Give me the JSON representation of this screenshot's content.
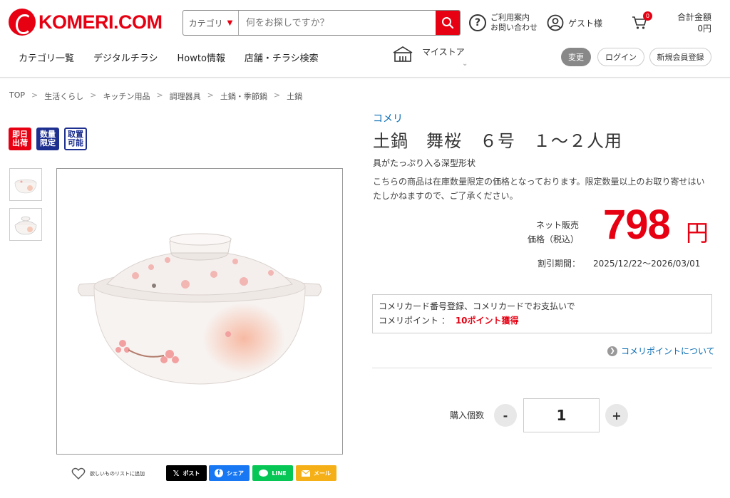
{
  "header": {
    "logo_text": "KOMERI.COM",
    "search": {
      "category_label": "カテゴリ",
      "placeholder": "何をお探しですか？"
    },
    "help_line1": "ご利用案内",
    "help_line2": "お問い合わせ",
    "guest_label": "ゲスト様",
    "cart_count": "0",
    "total_label": "合計金額",
    "total_value": "0円",
    "nav": [
      "カテゴリ一覧",
      "デジタルチラシ",
      "Howto情報",
      "店舗・チラシ検索"
    ],
    "mystore_label": "マイストア",
    "change_label": "変更",
    "login_label": "ログイン",
    "register_label": "新規会員登録"
  },
  "breadcrumb": [
    "TOP",
    "生活くらし",
    "キッチン用品",
    "調理器具",
    "土鍋・季節鍋",
    "土鍋"
  ],
  "badges": [
    {
      "text": "即日出荷",
      "color": "#e60012"
    },
    {
      "text": "数量限定",
      "color": "#1d2f8f"
    },
    {
      "text": "取置可能",
      "color": "#1d2f8f"
    }
  ],
  "share": {
    "wishlist_label": "欲しいものリストに追加",
    "post_label": "ポスト",
    "share_label": "シェア",
    "line_label": "LINE",
    "mail_label": "メール"
  },
  "product": {
    "brand": "コメリ",
    "title": "土鍋　舞桜　６号　１～２人用",
    "catch": "具がたっぷり入る深型形状",
    "description": "こちらの商品は在庫数量限定の価格となっております。限定数量以上のお取り寄せはいたしかねますので、ご了承ください。",
    "price_label_1": "ネット販売",
    "price_label_2": "価格（税込）",
    "price": "798",
    "currency": "円",
    "period_label": "割引期間：",
    "period_value": "2025/12/22～2026/03/01",
    "card_line": "コメリカード番号登録、コメリカードでお支払いで",
    "points_label": "コメリポイント ：",
    "points_value": "10ポイント獲得",
    "points_link": "コメリポイントについて",
    "qty_label": "購入個数",
    "qty_minus": "-",
    "qty_value": "1",
    "qty_plus": "+"
  },
  "colors": {
    "brand_red": "#e60012",
    "link_blue": "#0a6db3",
    "navy": "#1d2f8f"
  }
}
